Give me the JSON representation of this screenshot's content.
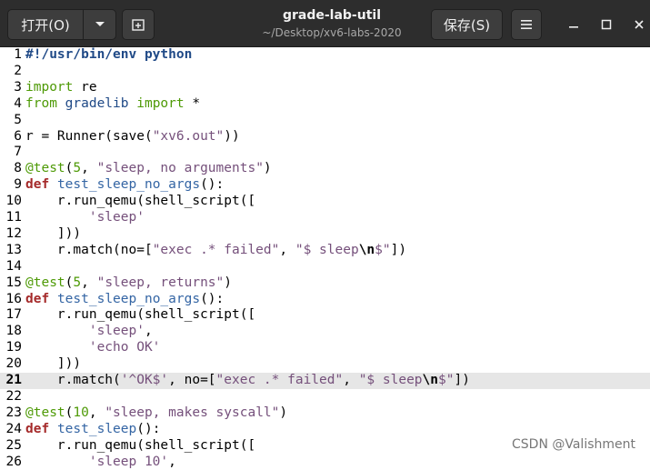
{
  "window": {
    "title": "grade-lab-util",
    "subtitle": "~/Desktop/xv6-labs-2020"
  },
  "toolbar": {
    "open_label": "打开(O)",
    "save_label": "保存(S)"
  },
  "editor": {
    "current_line": 21,
    "lines": [
      {
        "n": "1",
        "tokens": [
          {
            "t": "#!/usr/bin/env python",
            "c": "shebang"
          }
        ]
      },
      {
        "n": "2",
        "tokens": []
      },
      {
        "n": "3",
        "tokens": [
          {
            "t": "import",
            "c": "import"
          },
          {
            "t": " re",
            "c": "plain"
          }
        ]
      },
      {
        "n": "4",
        "tokens": [
          {
            "t": "from",
            "c": "import"
          },
          {
            "t": " ",
            "c": "plain"
          },
          {
            "t": "gradelib",
            "c": "mod"
          },
          {
            "t": " ",
            "c": "plain"
          },
          {
            "t": "import",
            "c": "import"
          },
          {
            "t": " *",
            "c": "plain"
          }
        ]
      },
      {
        "n": "5",
        "tokens": []
      },
      {
        "n": "6",
        "tokens": [
          {
            "t": "r = Runner(save(",
            "c": "plain"
          },
          {
            "t": "\"xv6.out\"",
            "c": "str"
          },
          {
            "t": "))",
            "c": "plain"
          }
        ]
      },
      {
        "n": "7",
        "tokens": []
      },
      {
        "n": "8",
        "tokens": [
          {
            "t": "@test",
            "c": "dec"
          },
          {
            "t": "(",
            "c": "plain"
          },
          {
            "t": "5",
            "c": "num"
          },
          {
            "t": ", ",
            "c": "plain"
          },
          {
            "t": "\"sleep, no arguments\"",
            "c": "str"
          },
          {
            "t": ")",
            "c": "plain"
          }
        ]
      },
      {
        "n": "9",
        "tokens": [
          {
            "t": "def",
            "c": "kw2"
          },
          {
            "t": " ",
            "c": "plain"
          },
          {
            "t": "test_sleep_no_args",
            "c": "fn"
          },
          {
            "t": "():",
            "c": "plain"
          }
        ]
      },
      {
        "n": "10",
        "tokens": [
          {
            "t": "    r.run_qemu(shell_script([",
            "c": "plain"
          }
        ]
      },
      {
        "n": "11",
        "tokens": [
          {
            "t": "        ",
            "c": "plain"
          },
          {
            "t": "'sleep'",
            "c": "str"
          }
        ]
      },
      {
        "n": "12",
        "tokens": [
          {
            "t": "    ]))",
            "c": "plain"
          }
        ]
      },
      {
        "n": "13",
        "tokens": [
          {
            "t": "    r.match(no=[",
            "c": "plain"
          },
          {
            "t": "\"exec .* failed\"",
            "c": "str"
          },
          {
            "t": ", ",
            "c": "plain"
          },
          {
            "t": "\"$ sleep",
            "c": "str"
          },
          {
            "t": "\\n",
            "c": "esc"
          },
          {
            "t": "$\"",
            "c": "str"
          },
          {
            "t": "])",
            "c": "plain"
          }
        ]
      },
      {
        "n": "14",
        "tokens": []
      },
      {
        "n": "15",
        "tokens": [
          {
            "t": "@test",
            "c": "dec"
          },
          {
            "t": "(",
            "c": "plain"
          },
          {
            "t": "5",
            "c": "num"
          },
          {
            "t": ", ",
            "c": "plain"
          },
          {
            "t": "\"sleep, returns\"",
            "c": "str"
          },
          {
            "t": ")",
            "c": "plain"
          }
        ]
      },
      {
        "n": "16",
        "tokens": [
          {
            "t": "def",
            "c": "kw2"
          },
          {
            "t": " ",
            "c": "plain"
          },
          {
            "t": "test_sleep_no_args",
            "c": "fn"
          },
          {
            "t": "():",
            "c": "plain"
          }
        ]
      },
      {
        "n": "17",
        "tokens": [
          {
            "t": "    r.run_qemu(shell_script([",
            "c": "plain"
          }
        ]
      },
      {
        "n": "18",
        "tokens": [
          {
            "t": "        ",
            "c": "plain"
          },
          {
            "t": "'sleep'",
            "c": "str"
          },
          {
            "t": ",",
            "c": "plain"
          }
        ]
      },
      {
        "n": "19",
        "tokens": [
          {
            "t": "        ",
            "c": "plain"
          },
          {
            "t": "'echo OK'",
            "c": "str"
          }
        ]
      },
      {
        "n": "20",
        "tokens": [
          {
            "t": "    ]))",
            "c": "plain"
          }
        ]
      },
      {
        "n": "21",
        "tokens": [
          {
            "t": "    r.match(",
            "c": "plain"
          },
          {
            "t": "'^OK$'",
            "c": "str"
          },
          {
            "t": ", no=[",
            "c": "plain"
          },
          {
            "t": "\"exec .* failed\"",
            "c": "str"
          },
          {
            "t": ", ",
            "c": "plain"
          },
          {
            "t": "\"$ sleep",
            "c": "str"
          },
          {
            "t": "\\n",
            "c": "esc"
          },
          {
            "t": "$\"",
            "c": "str"
          },
          {
            "t": "])",
            "c": "plain"
          }
        ]
      },
      {
        "n": "22",
        "tokens": []
      },
      {
        "n": "23",
        "tokens": [
          {
            "t": "@test",
            "c": "dec"
          },
          {
            "t": "(",
            "c": "plain"
          },
          {
            "t": "10",
            "c": "num"
          },
          {
            "t": ", ",
            "c": "plain"
          },
          {
            "t": "\"sleep, makes syscall\"",
            "c": "str"
          },
          {
            "t": ")",
            "c": "plain"
          }
        ]
      },
      {
        "n": "24",
        "tokens": [
          {
            "t": "def",
            "c": "kw2"
          },
          {
            "t": " ",
            "c": "plain"
          },
          {
            "t": "test_sleep",
            "c": "fn"
          },
          {
            "t": "():",
            "c": "plain"
          }
        ]
      },
      {
        "n": "25",
        "tokens": [
          {
            "t": "    r.run_qemu(shell_script([",
            "c": "plain"
          }
        ]
      },
      {
        "n": "26",
        "tokens": [
          {
            "t": "        ",
            "c": "plain"
          },
          {
            "t": "'sleep 10'",
            "c": "str"
          },
          {
            "t": ",",
            "c": "plain"
          }
        ]
      }
    ]
  },
  "watermark": "CSDN @Valishment"
}
